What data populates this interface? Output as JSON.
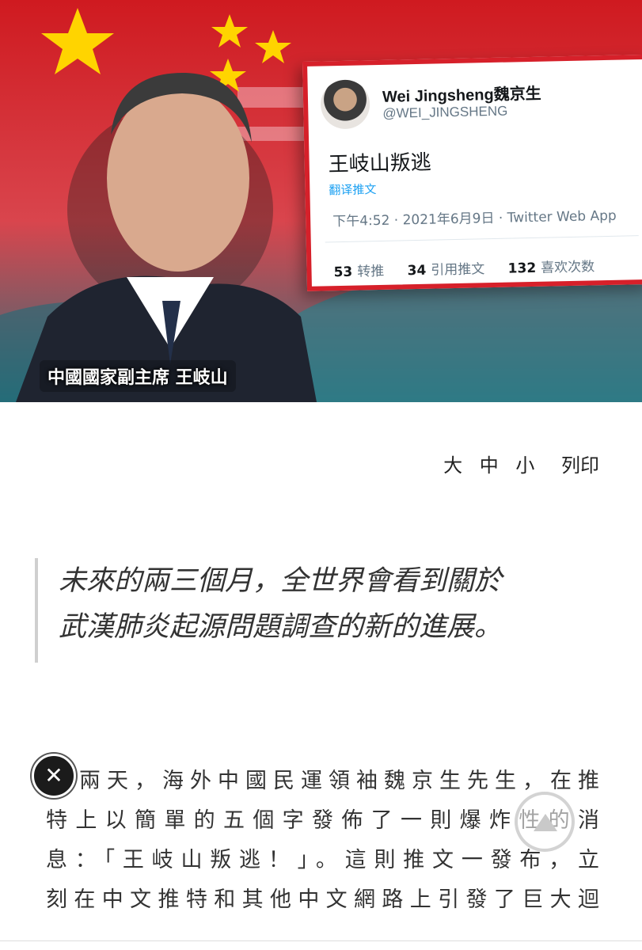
{
  "hero": {
    "caption": "中國國家副主席 王岐山",
    "tweet": {
      "name": "Wei Jingsheng魏京生",
      "handle": "@WEI_JINGSHENG",
      "text": "王岐山叛逃",
      "translate_label": "翻译推文",
      "timestamp": "下午4:52 · 2021年6月9日 · Twitter Web App",
      "stats": [
        {
          "count": "53",
          "label": "转推"
        },
        {
          "count": "34",
          "label": "引用推文"
        },
        {
          "count": "132",
          "label": "喜欢次数"
        }
      ]
    }
  },
  "font_tools": {
    "large": "大",
    "medium": "中",
    "small": "小",
    "print": "列印"
  },
  "quote": {
    "line1": "未來的兩三個月，全世界會看到關於",
    "line2": "武漢肺炎起源問題調查的新的進展。"
  },
  "article": {
    "lines": [
      "兩天，海外中國民運領袖魏京生先生，在推",
      "特上以簡單的五個字發佈了一則爆炸性的消",
      "息：「王岐山叛逃！」。這則推文一發布，立",
      "刻在中文推特和其他中文網路上引發了巨大迴"
    ]
  },
  "icons": {
    "close": "close-icon",
    "scroll_top": "arrow-up-icon"
  },
  "colors": {
    "flag_red": "#d81d22",
    "card_border": "#d6202a",
    "twitter_blue": "#1da1f2"
  }
}
